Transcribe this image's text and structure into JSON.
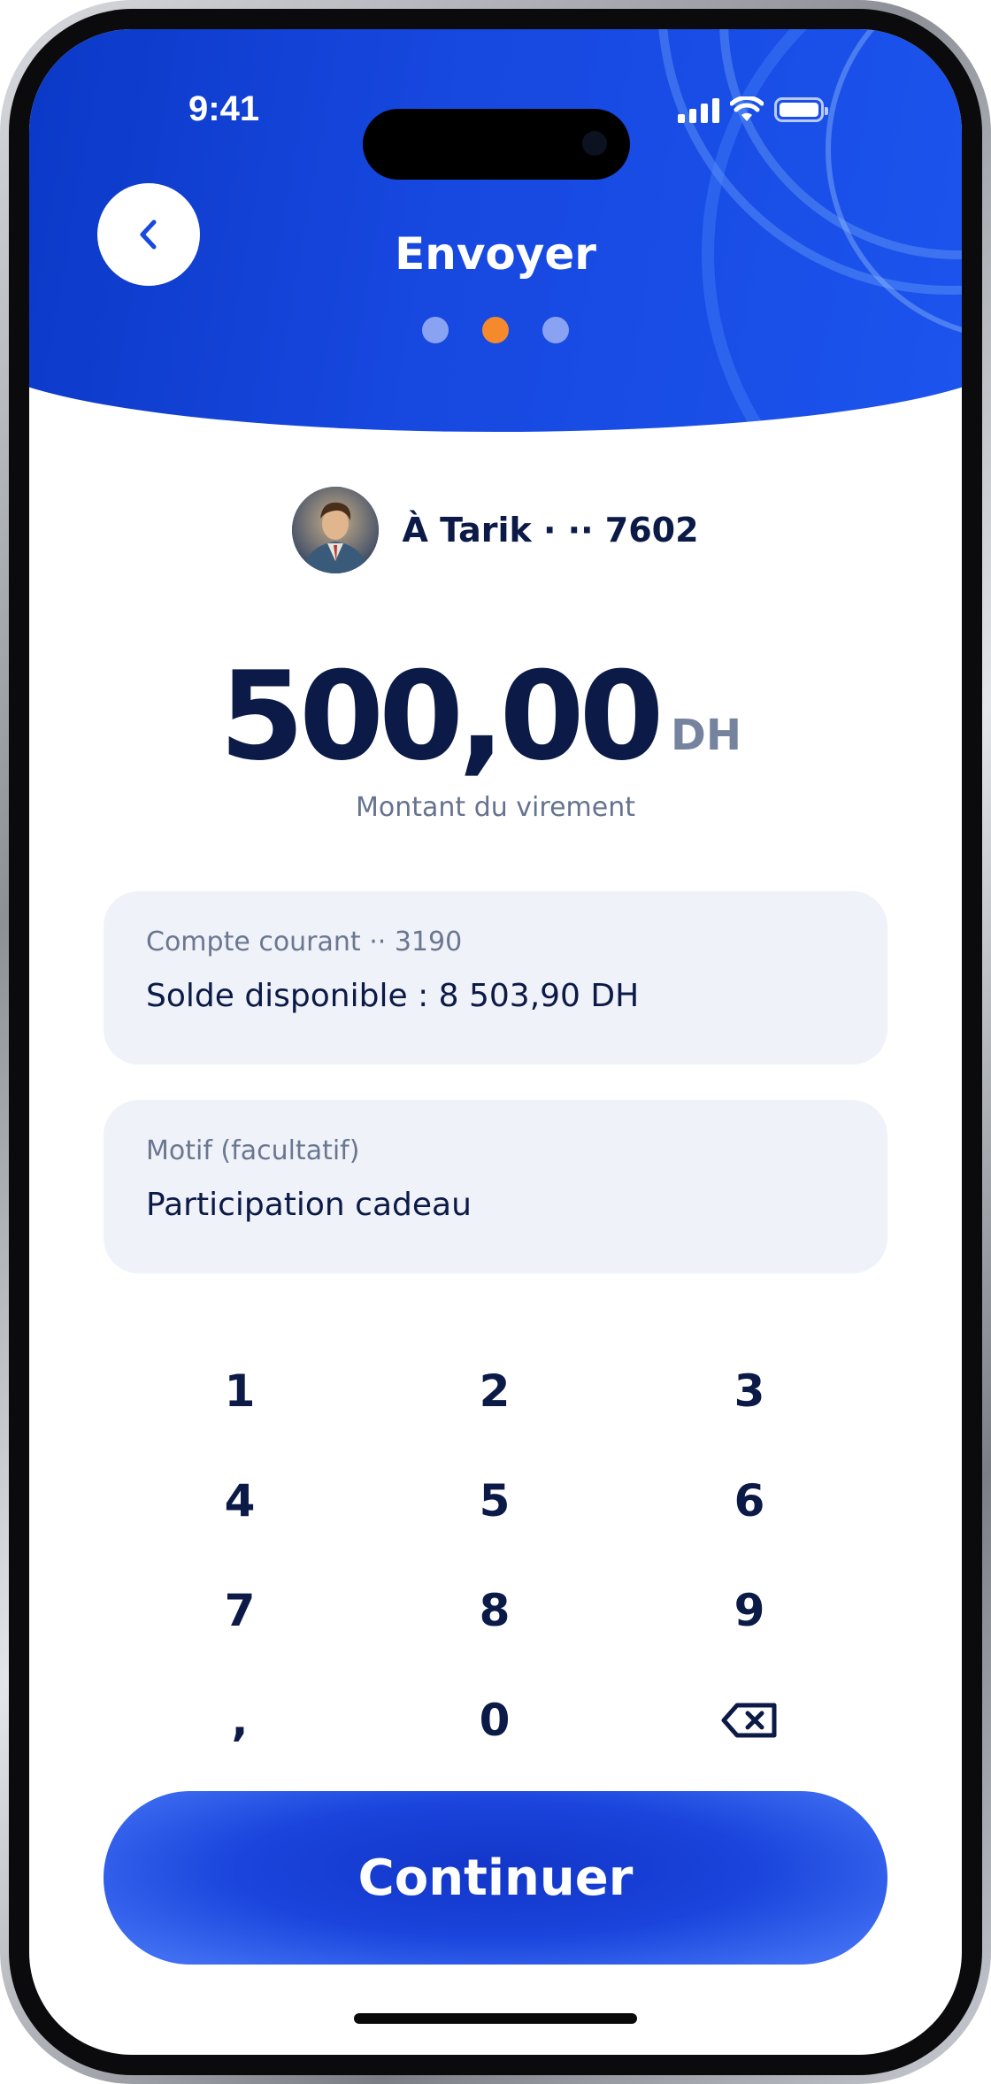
{
  "status_bar": {
    "time": "9:41"
  },
  "header": {
    "title": "Envoyer",
    "step_count": 3,
    "active_step": 2
  },
  "recipient": {
    "label": "À Tarik · ·· 7602"
  },
  "amount": {
    "value": "500,00",
    "currency": "DH",
    "caption": "Montant du virement"
  },
  "account_card": {
    "label": "Compte courant ·· 3190",
    "value": "Solde disponible : 8 503,90 DH"
  },
  "motif_card": {
    "label": "Motif (facultatif)",
    "value": "Participation cadeau"
  },
  "keypad": {
    "keys": [
      "1",
      "2",
      "3",
      "4",
      "5",
      "6",
      "7",
      "8",
      "9",
      ",",
      "0",
      "⌫"
    ]
  },
  "cta": {
    "label": "Continuer"
  },
  "colors": {
    "brand_blue": "#1748e0",
    "accent_orange": "#f6892c",
    "text_dark": "#0b1a46",
    "muted": "#76839f",
    "card_bg": "#f0f2f9"
  },
  "icons": {
    "back": "chevron-left-icon",
    "backspace": "backspace-icon"
  }
}
